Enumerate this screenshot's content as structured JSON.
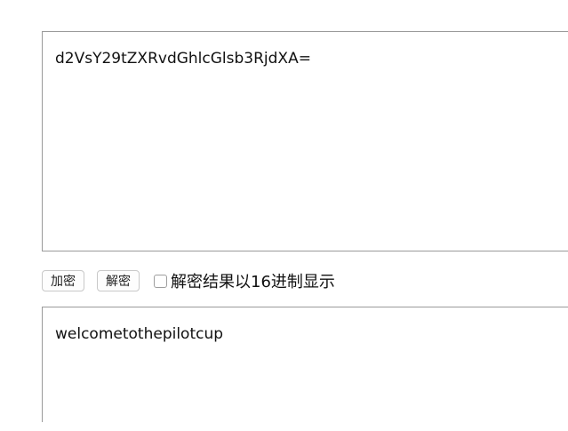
{
  "input": {
    "value": "d2VsY29tZXRvdGhlcGlsb3RjdXA="
  },
  "controls": {
    "encrypt_label": "加密",
    "decrypt_label": "解密",
    "hex_checkbox_label": "解密结果以16进制显示",
    "hex_checkbox_checked": false
  },
  "output": {
    "value": "welcometothepilotcup"
  }
}
